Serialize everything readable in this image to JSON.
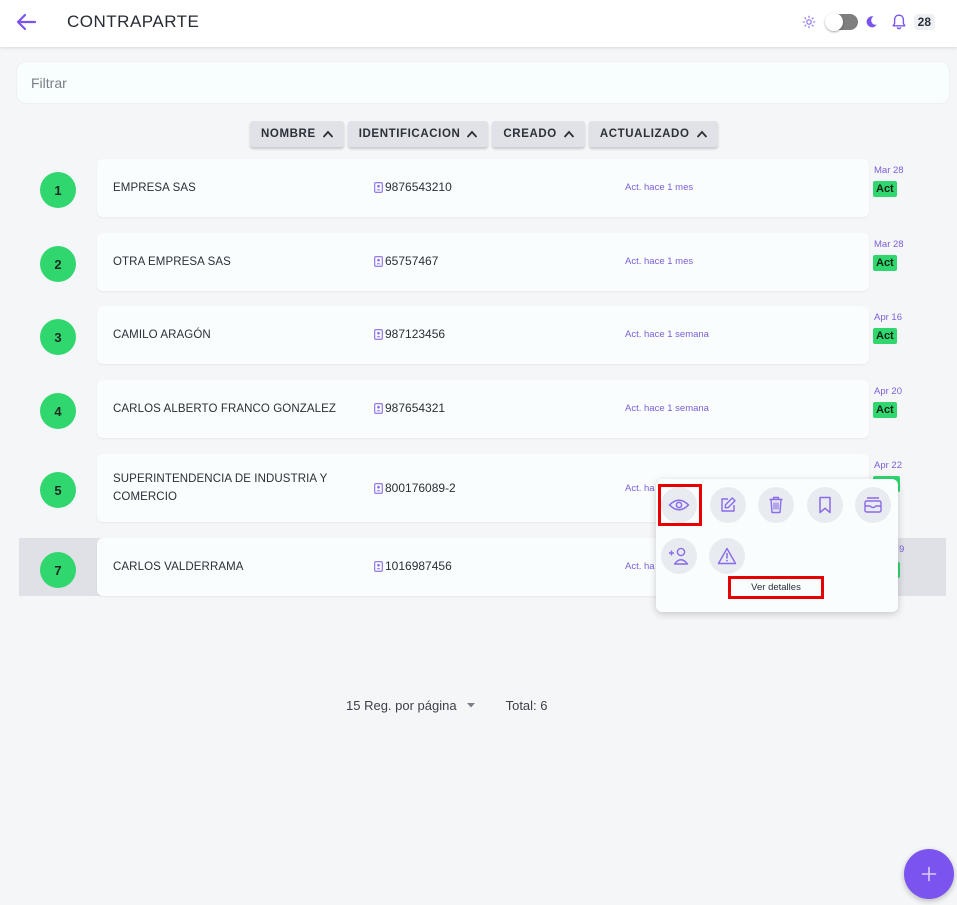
{
  "header": {
    "title": "CONTRAPARTE",
    "notification_count": "28",
    "accent_color": "#7b54f0"
  },
  "filter": {
    "placeholder": "Filtrar"
  },
  "sort": [
    {
      "label": "NOMBRE"
    },
    {
      "label": "IDENTIFICACION"
    },
    {
      "label": "CREADO"
    },
    {
      "label": "ACTUALIZADO"
    }
  ],
  "rows": [
    {
      "num": "1",
      "name": "EMPRESA SAS",
      "ident": "9876543210",
      "act": "Act. hace 1 mes",
      "date": "Mar 28",
      "status": "Act"
    },
    {
      "num": "2",
      "name": "OTRA EMPRESA SAS",
      "ident": "65757467",
      "act": "Act. hace 1 mes",
      "date": "Mar 28",
      "status": "Act"
    },
    {
      "num": "3",
      "name": "CAMILO ARAGÓN",
      "ident": "987123456",
      "act": "Act. hace 1 semana",
      "date": "Apr 16",
      "status": "Act"
    },
    {
      "num": "4",
      "name": "CARLOS ALBERTO FRANCO GONZALEZ",
      "ident": "987654321",
      "act": "Act. hace 1 semana",
      "date": "Apr 20",
      "status": "Act"
    },
    {
      "num": "5",
      "name": "SUPERINTENDENCIA DE INDUSTRIA Y COMERCIO",
      "ident": "800176089-2",
      "act": "Act. ha",
      "date": "Apr 22",
      "status": ""
    },
    {
      "num": "7",
      "name": "CARLOS VALDERRAMA",
      "ident": "1016987456",
      "act": "Act. ha",
      "date": "9",
      "status": ""
    }
  ],
  "actions_menu": {
    "icons": [
      "eye-icon",
      "edit-icon",
      "trash-icon",
      "bookmark-icon",
      "archive-icon",
      "add-user-icon",
      "warning-icon"
    ],
    "hover_label": "Ver detalles"
  },
  "pagination": {
    "per_page": "15 Reg. por página",
    "total": "Total: 6"
  }
}
